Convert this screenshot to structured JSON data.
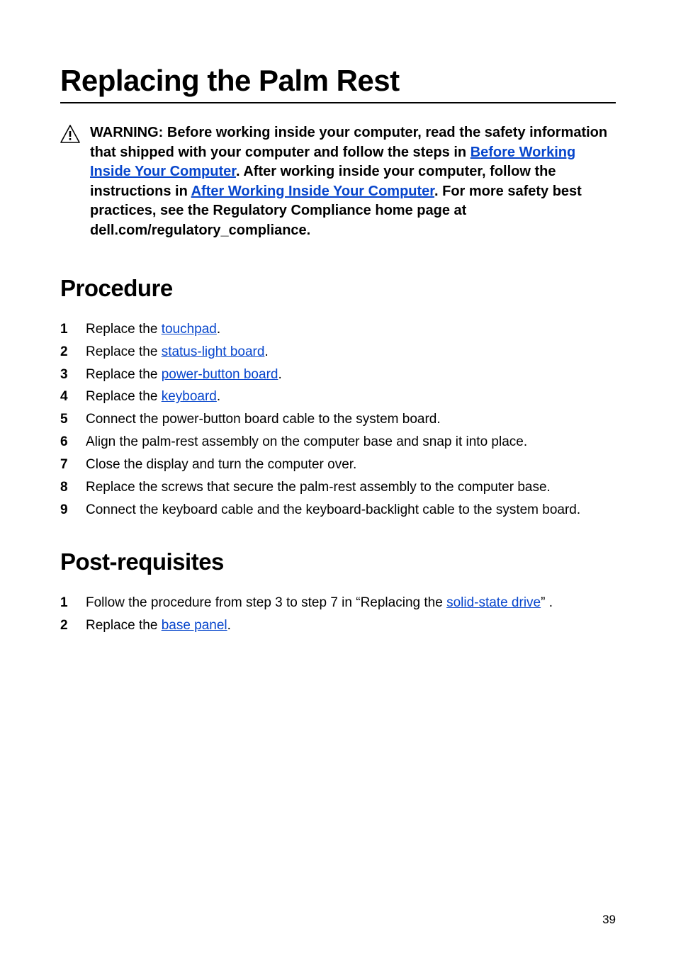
{
  "title": "Replacing the Palm Rest",
  "warning": {
    "pre1": "WARNING: Before working inside your computer, read the safety information that shipped with your computer and follow the steps in ",
    "link1": "Before Working Inside Your Computer",
    "mid1": ". After working inside your computer, follow the instructions in ",
    "link2": "After Working Inside Your Computer",
    "post1": ". For more safety best practices, see the Regulatory Compliance home page at dell.com/regulatory_compliance."
  },
  "sections": {
    "procedure": {
      "heading": "Procedure",
      "items": [
        {
          "pre": "Replace the ",
          "link": "touchpad",
          "post": "."
        },
        {
          "pre": "Replace the ",
          "link": "status-light board",
          "post": "."
        },
        {
          "pre": "Replace the ",
          "link": "power-button board",
          "post": "."
        },
        {
          "pre": "Replace the ",
          "link": "keyboard",
          "post": "."
        },
        {
          "text": "Connect the power-button board cable to the system board."
        },
        {
          "text": "Align the palm-rest assembly on the computer base and snap it into place."
        },
        {
          "text": "Close the display and turn the computer over."
        },
        {
          "text": "Replace the screws that secure the palm-rest assembly to the computer base."
        },
        {
          "text": "Connect the keyboard cable and the keyboard-backlight cable to the system board."
        }
      ]
    },
    "postreq": {
      "heading": "Post-requisites",
      "items": [
        {
          "pre": "Follow the procedure from step 3 to step 7 in “Replacing the ",
          "link": "solid-state drive",
          "post": "” ."
        },
        {
          "pre": "Replace the ",
          "link": "base panel",
          "post": "."
        }
      ]
    }
  },
  "page_number": "39"
}
